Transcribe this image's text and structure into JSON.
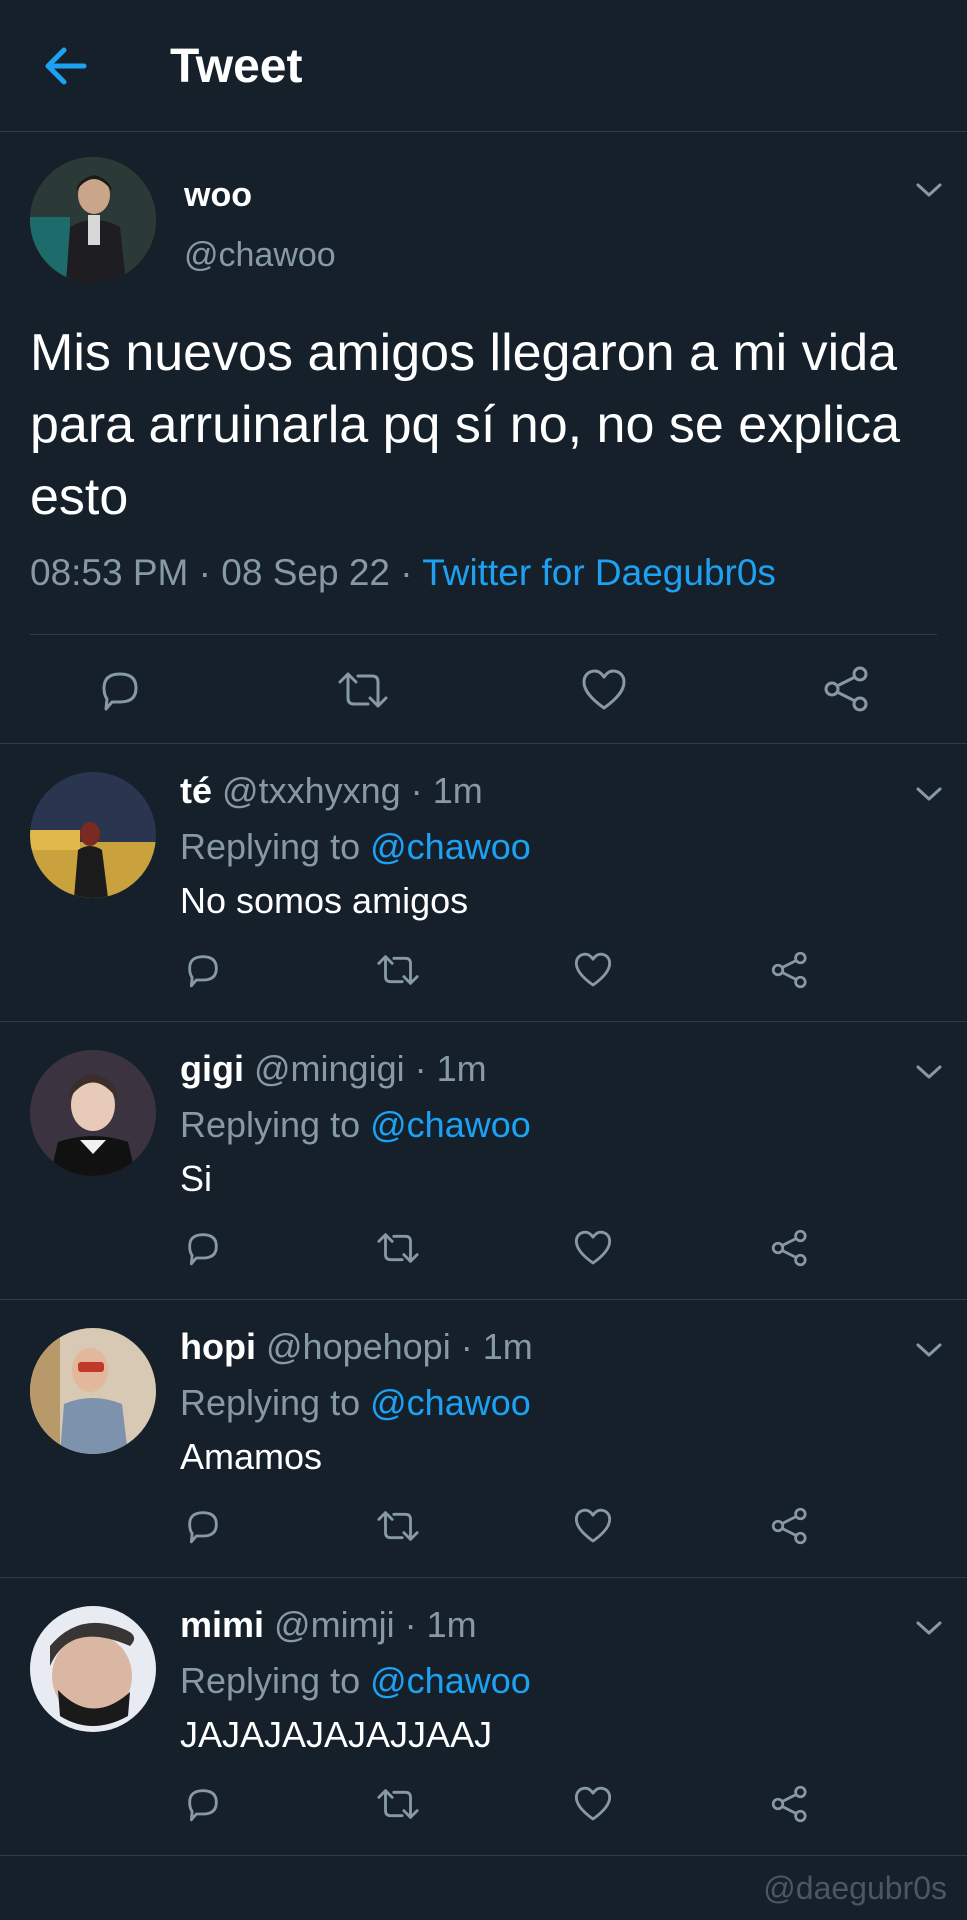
{
  "header": {
    "title": "Tweet",
    "back_icon": "arrow-left-icon"
  },
  "colors": {
    "background": "#15202b",
    "accent": "#1da1f2",
    "muted": "#8899a6",
    "divider": "#2f3b47"
  },
  "main_tweet": {
    "name": "woo",
    "handle": "@chawoo",
    "text": "Mis nuevos amigos llegaron a mi vida para arruinarla pq sí no, no se explica esto",
    "time": "08:53 PM",
    "separator": "·",
    "date": "08 Sep 22",
    "source": "Twitter for Daegubr0s"
  },
  "replies": [
    {
      "name": "té",
      "handle": "@txxhyxng",
      "dot": "·",
      "time": "1m",
      "replying_prefix": "Replying to",
      "replying_to": "@chawoo",
      "text": "No somos amigos"
    },
    {
      "name": "gigi",
      "handle": "@mingigi",
      "dot": "·",
      "time": "1m",
      "replying_prefix": "Replying to",
      "replying_to": "@chawoo",
      "text": "Si"
    },
    {
      "name": "hopi",
      "handle": "@hopehopi",
      "dot": "·",
      "time": "1m",
      "replying_prefix": "Replying to",
      "replying_to": "@chawoo",
      "text": "Amamos"
    },
    {
      "name": "mimi",
      "handle": "@mimji",
      "dot": "·",
      "time": "1m",
      "replying_prefix": "Replying to",
      "replying_to": "@chawoo",
      "text": "JAJAJAJAJAJJAAJ"
    }
  ],
  "action_icons": [
    "reply-icon",
    "retweet-icon",
    "like-icon",
    "share-icon"
  ],
  "watermark": "@daegubr0s"
}
